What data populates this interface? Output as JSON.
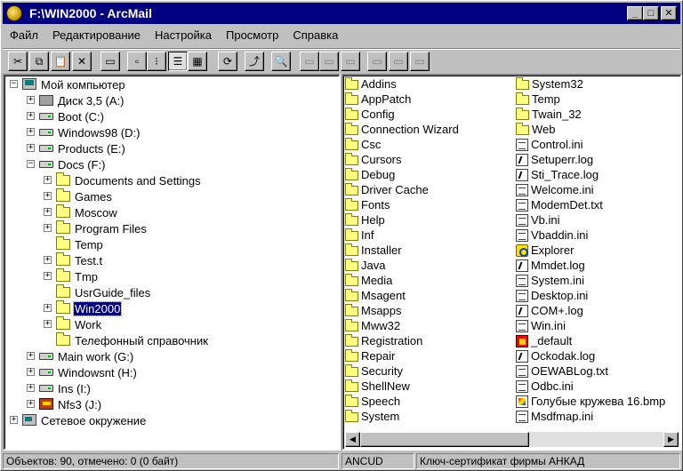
{
  "window": {
    "title": "F:\\WIN2000 - ArcMail",
    "minimize_glyph": "_",
    "maximize_glyph": "□",
    "close_glyph": "✕"
  },
  "menu": [
    "Файл",
    "Редактирование",
    "Настройка",
    "Просмотр",
    "Справка"
  ],
  "toolbar": {
    "tools": [
      {
        "icon": "scissors-icon",
        "glyph": "✂",
        "state": "normal"
      },
      {
        "icon": "copy-icon",
        "glyph": "⧉",
        "state": "normal"
      },
      {
        "icon": "paste-icon",
        "glyph": "📋",
        "state": "normal"
      },
      {
        "icon": "delete-icon",
        "glyph": "✕",
        "state": "normal"
      },
      {
        "icon": "new-folder-icon",
        "glyph": "▭",
        "state": "normal"
      },
      {
        "icon": "large-icons-view-icon",
        "glyph": "▫",
        "state": "normal"
      },
      {
        "icon": "small-icons-view-icon",
        "glyph": "⁝",
        "state": "normal"
      },
      {
        "icon": "list-view-icon",
        "glyph": "☰",
        "state": "pressed"
      },
      {
        "icon": "details-view-icon",
        "glyph": "▦",
        "state": "normal"
      },
      {
        "icon": "refresh-icon",
        "glyph": "⟳",
        "state": "normal"
      },
      {
        "icon": "up-folder-icon",
        "glyph": "⤴",
        "state": "normal"
      },
      {
        "icon": "properties-icon",
        "glyph": "🔍",
        "state": "disabled"
      },
      {
        "icon": "mail-icon-1",
        "glyph": "▭",
        "state": "disabled"
      },
      {
        "icon": "mail-icon-2",
        "glyph": "▭",
        "state": "disabled"
      },
      {
        "icon": "mail-icon-3",
        "glyph": "▭",
        "state": "disabled"
      },
      {
        "icon": "archive-icon-1",
        "glyph": "▭",
        "state": "disabled"
      },
      {
        "icon": "archive-icon-2",
        "glyph": "▭",
        "state": "disabled"
      },
      {
        "icon": "archive-icon-3",
        "glyph": "▭",
        "state": "disabled"
      }
    ]
  },
  "tree": [
    {
      "label": "Мой компьютер",
      "level": 0,
      "icon": "computer",
      "expander": "−"
    },
    {
      "label": "Диск 3,5 (A:)",
      "level": 1,
      "icon": "floppy",
      "expander": "+"
    },
    {
      "label": "Boot (C:)",
      "level": 1,
      "icon": "drive",
      "expander": "+"
    },
    {
      "label": "Windows98 (D:)",
      "level": 1,
      "icon": "drive",
      "expander": "+"
    },
    {
      "label": "Products (E:)",
      "level": 1,
      "icon": "drive",
      "expander": "+"
    },
    {
      "label": "Docs (F:)",
      "level": 1,
      "icon": "drive",
      "expander": "−"
    },
    {
      "label": "Documents and Settings",
      "level": 2,
      "icon": "folder",
      "expander": "+"
    },
    {
      "label": "Games",
      "level": 2,
      "icon": "folder",
      "expander": "+"
    },
    {
      "label": "Moscow",
      "level": 2,
      "icon": "folder",
      "expander": "+"
    },
    {
      "label": "Program Files",
      "level": 2,
      "icon": "folder",
      "expander": "+"
    },
    {
      "label": "Temp",
      "level": 2,
      "icon": "folder",
      "expander": ""
    },
    {
      "label": "Test.t",
      "level": 2,
      "icon": "folder",
      "expander": "+"
    },
    {
      "label": "Tmp",
      "level": 2,
      "icon": "folder",
      "expander": "+"
    },
    {
      "label": "UsrGuide_files",
      "level": 2,
      "icon": "folder",
      "expander": ""
    },
    {
      "label": "Win2000",
      "level": 2,
      "icon": "folder-open",
      "expander": "+",
      "selected": true
    },
    {
      "label": "Work",
      "level": 2,
      "icon": "folder",
      "expander": "+"
    },
    {
      "label": "Телефонный справочник",
      "level": 2,
      "icon": "folder",
      "expander": ""
    },
    {
      "label": "Main work (G:)",
      "level": 1,
      "icon": "drive",
      "expander": "+"
    },
    {
      "label": "Windowsnt (H:)",
      "level": 1,
      "icon": "drive",
      "expander": "+"
    },
    {
      "label": "Ins (I:)",
      "level": 1,
      "icon": "drive",
      "expander": "+"
    },
    {
      "label": "Nfs3 (J:)",
      "level": 1,
      "icon": "nfs",
      "expander": "+"
    },
    {
      "label": "Сетевое окружение",
      "level": 0,
      "icon": "network",
      "expander": "+"
    }
  ],
  "files": {
    "column1": [
      {
        "name": "Addins",
        "type": "folder"
      },
      {
        "name": "AppPatch",
        "type": "folder"
      },
      {
        "name": "Config",
        "type": "folder"
      },
      {
        "name": "Connection Wizard",
        "type": "folder"
      },
      {
        "name": "Csc",
        "type": "folder"
      },
      {
        "name": "Cursors",
        "type": "folder"
      },
      {
        "name": "Debug",
        "type": "folder"
      },
      {
        "name": "Driver Cache",
        "type": "folder"
      },
      {
        "name": "Fonts",
        "type": "folder"
      },
      {
        "name": "Help",
        "type": "folder"
      },
      {
        "name": "Inf",
        "type": "folder"
      },
      {
        "name": "Installer",
        "type": "folder"
      },
      {
        "name": "Java",
        "type": "folder"
      },
      {
        "name": "Media",
        "type": "folder"
      },
      {
        "name": "Msagent",
        "type": "folder"
      },
      {
        "name": "Msapps",
        "type": "folder"
      },
      {
        "name": "Mww32",
        "type": "folder"
      },
      {
        "name": "Registration",
        "type": "folder"
      },
      {
        "name": "Repair",
        "type": "folder"
      },
      {
        "name": "Security",
        "type": "folder"
      },
      {
        "name": "ShellNew",
        "type": "folder"
      },
      {
        "name": "Speech",
        "type": "folder"
      },
      {
        "name": "System",
        "type": "folder"
      }
    ],
    "column2": [
      {
        "name": "System32",
        "type": "folder"
      },
      {
        "name": "Temp",
        "type": "folder"
      },
      {
        "name": "Twain_32",
        "type": "folder"
      },
      {
        "name": "Web",
        "type": "folder"
      },
      {
        "name": "Control.ini",
        "type": "doc"
      },
      {
        "name": "Setuperr.log",
        "type": "log"
      },
      {
        "name": "Sti_Trace.log",
        "type": "log"
      },
      {
        "name": "Welcome.ini",
        "type": "doc"
      },
      {
        "name": "ModemDet.txt",
        "type": "doc"
      },
      {
        "name": "Vb.ini",
        "type": "doc"
      },
      {
        "name": "Vbaddin.ini",
        "type": "doc"
      },
      {
        "name": "Explorer",
        "type": "explorer"
      },
      {
        "name": "Mmdet.log",
        "type": "log"
      },
      {
        "name": "System.ini",
        "type": "doc"
      },
      {
        "name": "Desktop.ini",
        "type": "doc"
      },
      {
        "name": "COM+.log",
        "type": "log"
      },
      {
        "name": "Win.ini",
        "type": "doc"
      },
      {
        "name": "_default",
        "type": "special"
      },
      {
        "name": "Ockodak.log",
        "type": "log"
      },
      {
        "name": "OEWABLog.txt",
        "type": "doc"
      },
      {
        "name": "Odbc.ini",
        "type": "doc"
      },
      {
        "name": "Голубые кружева 16.bmp",
        "type": "bmp"
      },
      {
        "name": "Msdfmap.ini",
        "type": "doc"
      }
    ]
  },
  "scrollbar": {
    "left_glyph": "◀",
    "right_glyph": "▶"
  },
  "status": {
    "objects": "Объектов: 90, отмечено: 0  (0 байт)",
    "user": "ANCUD",
    "certificate": "Ключ-сертификат фирмы АНКАД"
  }
}
